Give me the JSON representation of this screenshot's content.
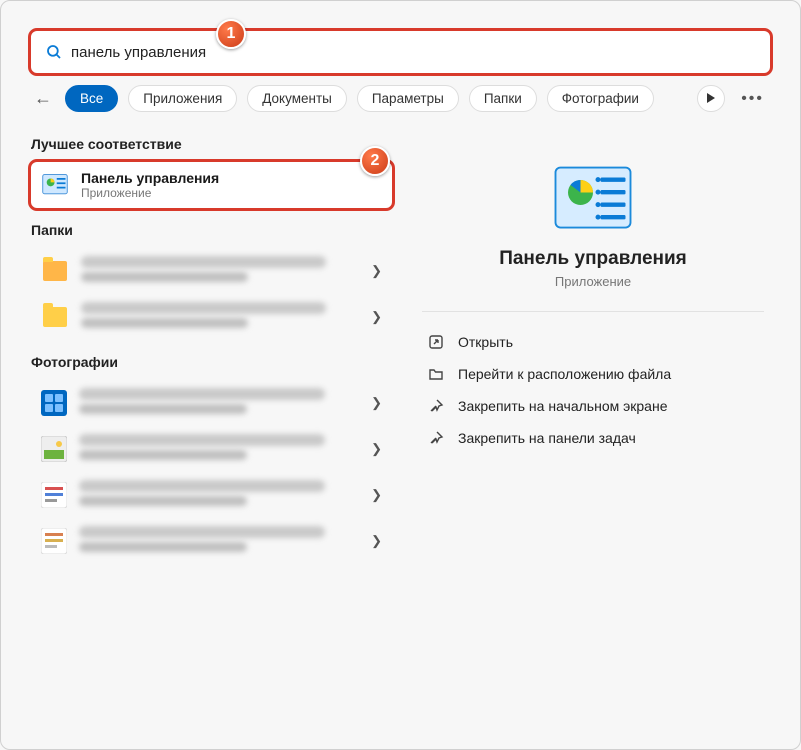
{
  "search": {
    "value": "панель управления"
  },
  "filters": {
    "items": [
      {
        "label": "Все",
        "active": true
      },
      {
        "label": "Приложения"
      },
      {
        "label": "Документы"
      },
      {
        "label": "Параметры"
      },
      {
        "label": "Папки"
      },
      {
        "label": "Фотографии"
      }
    ]
  },
  "sections": {
    "best": "Лучшее соответствие",
    "folders": "Папки",
    "photos": "Фотографии"
  },
  "best_match": {
    "title": "Панель управления",
    "subtitle": "Приложение"
  },
  "detail": {
    "title": "Панель управления",
    "subtitle": "Приложение",
    "actions": [
      {
        "label": "Открыть"
      },
      {
        "label": "Перейти к расположению файла"
      },
      {
        "label": "Закрепить на начальном экране"
      },
      {
        "label": "Закрепить на панели задач"
      }
    ]
  },
  "callouts": {
    "1": "1",
    "2": "2"
  }
}
